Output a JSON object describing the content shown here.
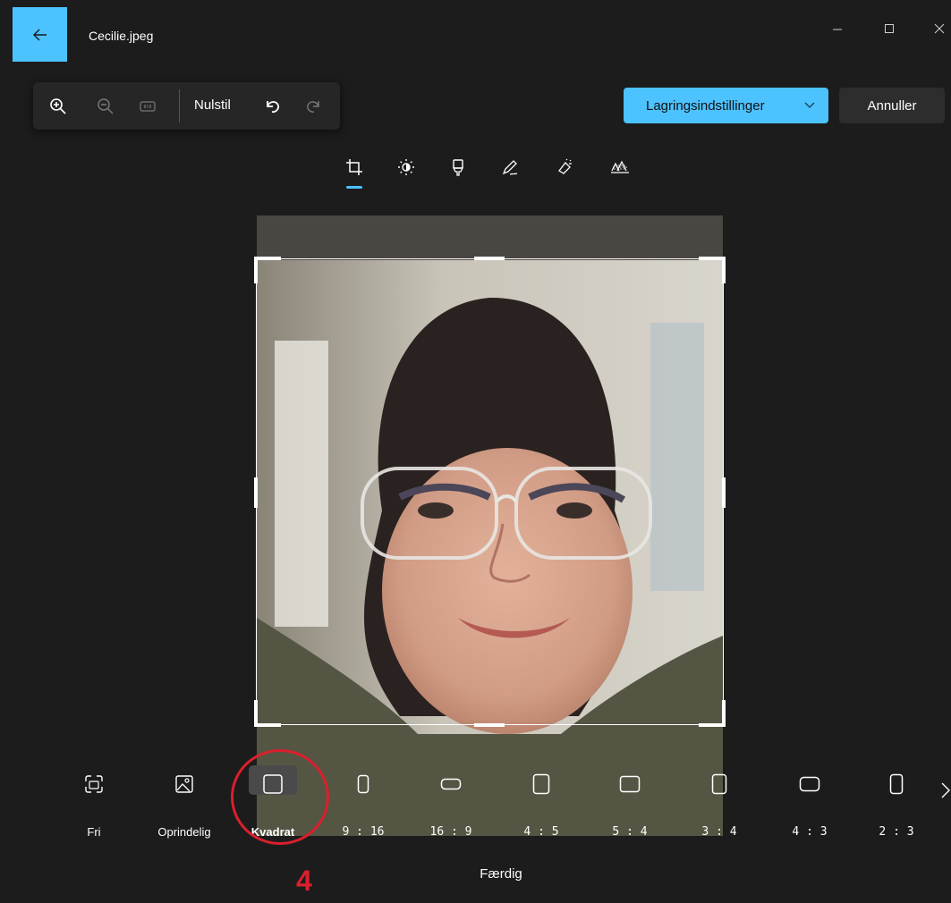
{
  "window": {
    "title": "Cecilie.jpeg",
    "accent_color": "#4cc2ff",
    "icons": {
      "back": "arrow-left-icon",
      "minimize": "minimize-icon",
      "maximize": "maximize-icon",
      "close": "close-icon"
    }
  },
  "toolbar": {
    "zoom_in_icon": "zoom-in-icon",
    "zoom_out_icon": "zoom-out-icon",
    "actual_size_icon": "actual-size-icon",
    "reset_label": "Nulstil",
    "undo_icon": "undo-icon",
    "redo_icon": "redo-icon"
  },
  "actions": {
    "save_label": "Lagringsindstillinger",
    "cancel_label": "Annuller"
  },
  "tools": [
    {
      "name": "crop",
      "icon": "crop-icon",
      "active": true
    },
    {
      "name": "adjust",
      "icon": "brightness-icon",
      "active": false
    },
    {
      "name": "filter",
      "icon": "filter-icon",
      "active": false
    },
    {
      "name": "markup",
      "icon": "markup-icon",
      "active": false
    },
    {
      "name": "erase",
      "icon": "erase-icon",
      "active": false
    },
    {
      "name": "background",
      "icon": "background-icon",
      "active": false
    }
  ],
  "aspect_ratios": [
    {
      "label": "Fri",
      "icon": "free-crop-icon",
      "selected": false
    },
    {
      "label": "Oprindelig",
      "icon": "original-image-icon",
      "selected": false
    },
    {
      "label": "Kvadrat",
      "icon": "square-icon",
      "selected": true
    },
    {
      "label": "9 : 16",
      "icon": "portrait-ratio-icon",
      "selected": false
    },
    {
      "label": "16 : 9",
      "icon": "landscape-ratio-icon",
      "selected": false
    },
    {
      "label": "4 : 5",
      "icon": "portrait-ratio-icon",
      "selected": false
    },
    {
      "label": "5 : 4",
      "icon": "landscape-ratio-icon",
      "selected": false
    },
    {
      "label": "3 : 4",
      "icon": "portrait-ratio-icon",
      "selected": false
    },
    {
      "label": "4 : 3",
      "icon": "landscape-ratio-icon",
      "selected": false
    },
    {
      "label": "2 : 3",
      "icon": "portrait-ratio-icon",
      "selected": false
    }
  ],
  "done_label": "Færdig",
  "annotation": {
    "number": "4",
    "color": "#d9202c"
  }
}
